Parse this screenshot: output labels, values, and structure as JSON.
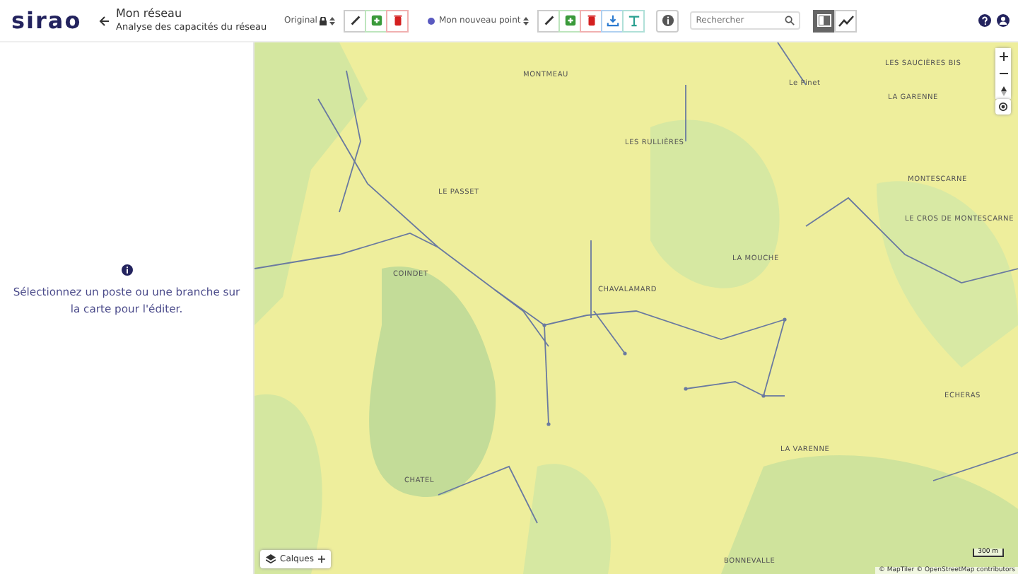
{
  "header": {
    "logo": "sirao",
    "title": "Mon réseau",
    "subtitle": "Analyse des capacités du réseau"
  },
  "toolbar": {
    "scenario_select": "Original",
    "scenario_locked": true,
    "point_select": "Mon nouveau point",
    "scenario_actions": [
      {
        "kind": "edit"
      },
      {
        "kind": "add"
      },
      {
        "kind": "delete"
      }
    ],
    "point_actions": [
      {
        "kind": "edit"
      },
      {
        "kind": "add"
      },
      {
        "kind": "delete"
      },
      {
        "kind": "download"
      },
      {
        "kind": "filter"
      }
    ],
    "search": {
      "placeholder": "Rechercher"
    },
    "views": [
      {
        "kind": "panel",
        "selected": true
      },
      {
        "kind": "chart",
        "selected": false
      }
    ]
  },
  "side_panel": {
    "message": "Sélectionnez un poste ou une branche sur la carte pour l'éditer."
  },
  "map": {
    "labels": [
      {
        "text": "MONTMEAU"
      },
      {
        "text": "LES RULLIÈRES"
      },
      {
        "text": "LE PASSET"
      },
      {
        "text": "COINDET"
      },
      {
        "text": "CHAVALAMARD"
      },
      {
        "text": "LA MOUCHE"
      },
      {
        "text": "LA VARENNE"
      },
      {
        "text": "BONNEVALLE"
      },
      {
        "text": "CHATEL"
      },
      {
        "text": "LES SAUCIÈRES BIS"
      },
      {
        "text": "LA GARENNE"
      },
      {
        "text": "MONTESCARNE"
      },
      {
        "text": "LE CROS DE MONTESCARNE"
      },
      {
        "text": "ECHERAS"
      },
      {
        "text": "Le Pinet"
      }
    ],
    "layers_button": "Calques",
    "scale": "300 m",
    "attribution": "© MapTiler © OpenStreetMap contributors"
  }
}
